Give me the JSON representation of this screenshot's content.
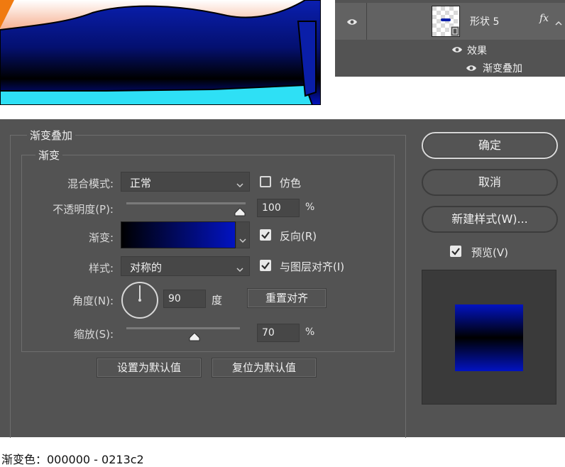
{
  "layers_panel": {
    "layer_name": "形状 5",
    "fx_label": "fx",
    "effects_label": "效果",
    "effect_item": "渐变叠加"
  },
  "dialog": {
    "section_title": "渐变叠加",
    "subsection_title": "渐变",
    "blend_mode": {
      "label": "混合模式:",
      "value": "正常"
    },
    "dither": {
      "label": "仿色",
      "checked": false
    },
    "opacity": {
      "label": "不透明度(P):",
      "value": "100",
      "unit": "%",
      "fraction": 1.0
    },
    "gradient": {
      "label": "渐变:",
      "color_start": "#000000",
      "color_end": "#0213c2"
    },
    "reverse": {
      "label": "反向(R)",
      "checked": true
    },
    "style": {
      "label": "样式:",
      "value": "对称的"
    },
    "align_with_layer": {
      "label": "与图层对齐(I)",
      "checked": true
    },
    "angle": {
      "label": "角度(N):",
      "value": "90",
      "unit": "度"
    },
    "reset_alignment_button": "重置对齐",
    "scale": {
      "label": "缩放(S):",
      "value": "70",
      "unit": "%",
      "fraction": 0.7
    },
    "make_default_button": "设置为默认值",
    "reset_default_button": "复位为默认值",
    "ok_button": "确定",
    "cancel_button": "取消",
    "new_style_button": "新建样式(W)...",
    "preview": {
      "label": "预览(V)",
      "checked": true
    }
  },
  "caption": "渐变色：000000 - 0213c2",
  "colors": {
    "panel_bg": "#535353",
    "gradient_start": "#000000",
    "gradient_end": "#0213c2",
    "accent_cyan": "#2ee0f5",
    "accent_orange": "#f07a10"
  }
}
